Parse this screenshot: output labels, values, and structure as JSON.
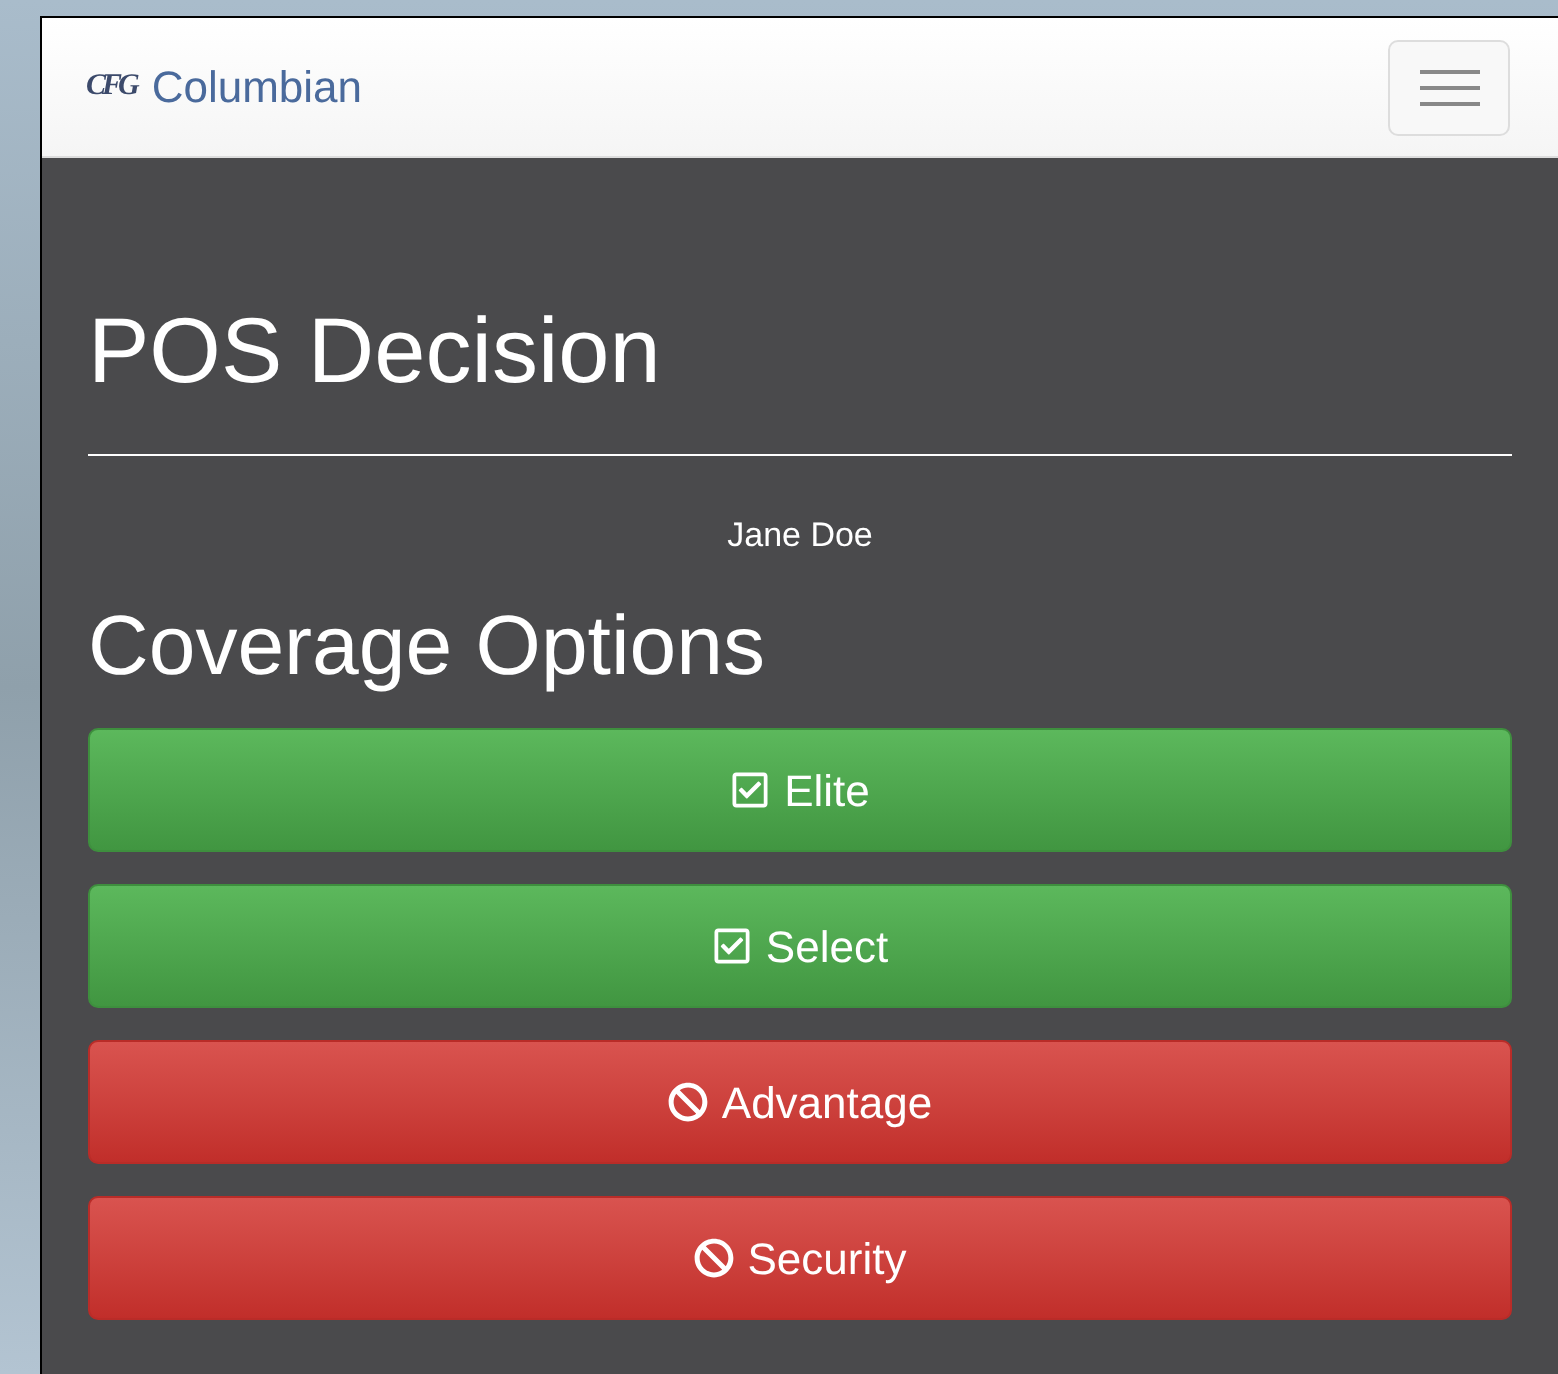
{
  "navbar": {
    "logo_text": "CFG",
    "brand": "Columbian"
  },
  "page": {
    "title": "POS Decision",
    "client_name": "Jane Doe",
    "section_title": "Coverage Options"
  },
  "coverage_options": [
    {
      "label": "Elite",
      "kind": "included"
    },
    {
      "label": "Select",
      "kind": "included"
    },
    {
      "label": "Advantage",
      "kind": "excluded"
    },
    {
      "label": "Security",
      "kind": "excluded"
    }
  ]
}
